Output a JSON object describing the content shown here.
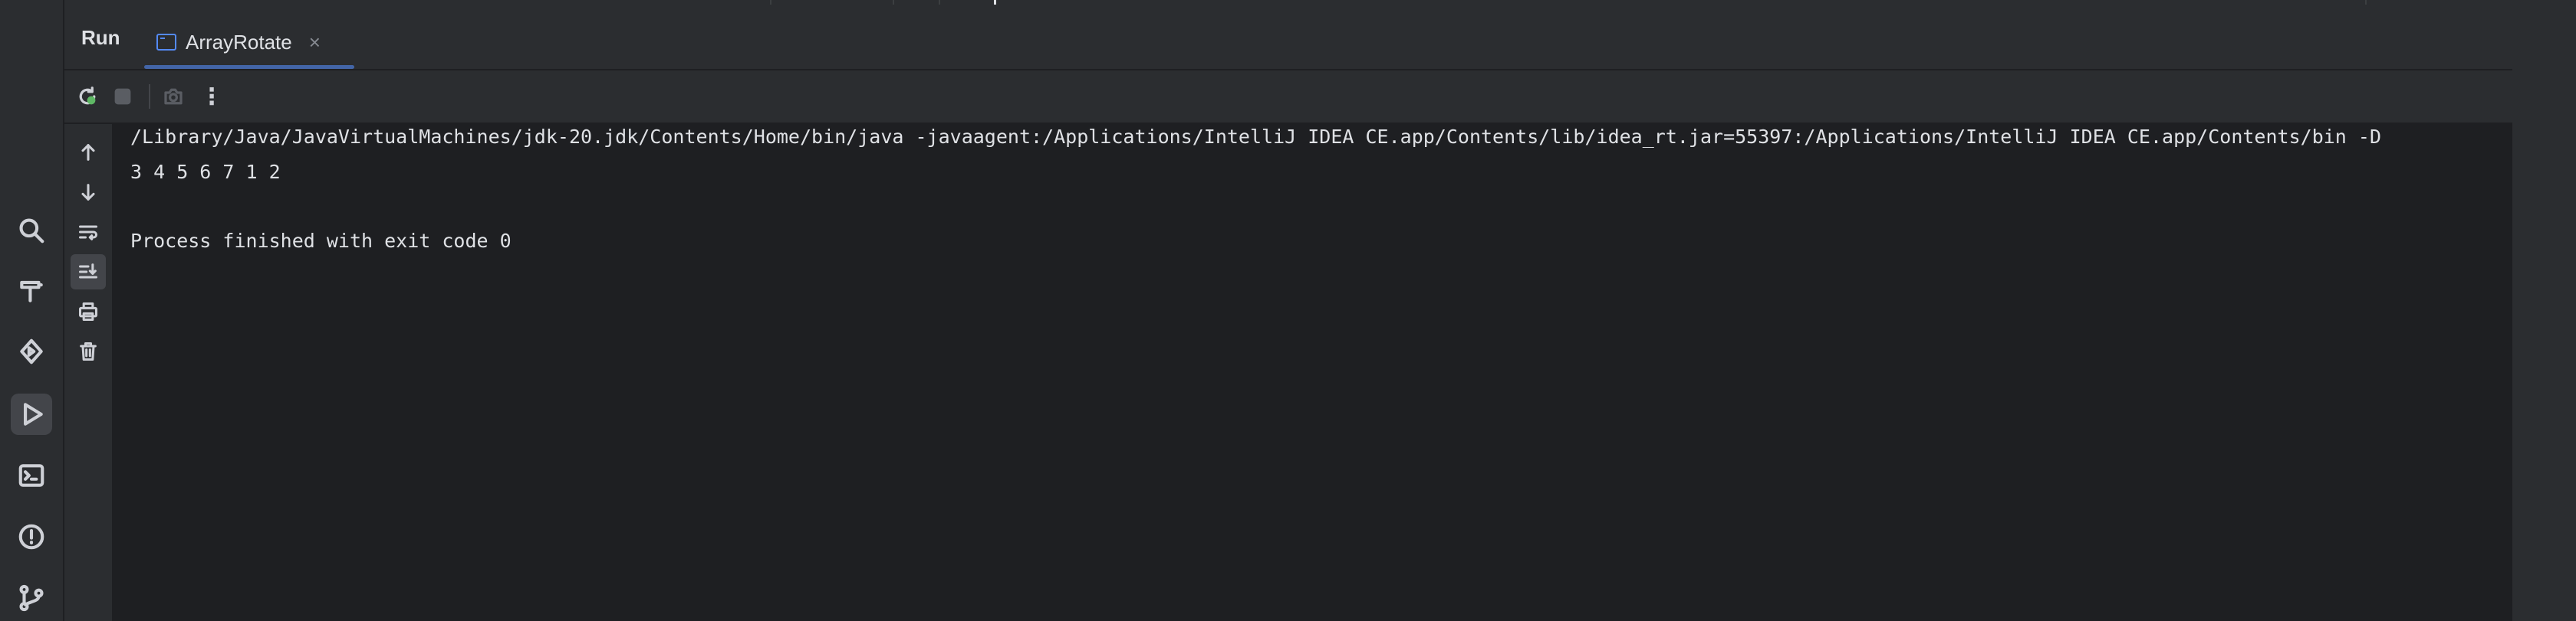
{
  "header": {
    "title": "Run",
    "tab": {
      "label": "ArrayRotate",
      "icon": "console-icon",
      "close": "×"
    }
  },
  "left_strip": {
    "tools": [
      {
        "icon": "search-icon",
        "active": false
      },
      {
        "icon": "build-hammer-icon",
        "active": false
      },
      {
        "icon": "services-icon",
        "active": false
      },
      {
        "icon": "run-icon",
        "active": true
      },
      {
        "icon": "terminal-icon",
        "active": false
      },
      {
        "icon": "problems-icon",
        "active": false
      },
      {
        "icon": "git-branch-icon",
        "active": false
      }
    ]
  },
  "toolbar": {
    "buttons": [
      "rerun-icon",
      "stop-icon",
      "screenshot-icon",
      "more-icon"
    ],
    "more_label": "⋮"
  },
  "side_actions": [
    "up-arrow-icon",
    "down-arrow-icon",
    "soft-wrap-icon",
    "scroll-to-end-icon",
    "print-icon",
    "trash-icon"
  ],
  "console": {
    "lines": [
      "/Library/Java/JavaVirtualMachines/jdk-20.jdk/Contents/Home/bin/java -javaagent:/Applications/IntelliJ IDEA CE.app/Contents/lib/idea_rt.jar=55397:/Applications/IntelliJ IDEA CE.app/Contents/bin -D",
      "3 4 5 6 7 1 2",
      "",
      "Process finished with exit code 0"
    ]
  },
  "colors": {
    "accent": "#548af7",
    "background": "#1e1f22",
    "panel": "#2b2d30",
    "text": "#dfe1e5"
  }
}
